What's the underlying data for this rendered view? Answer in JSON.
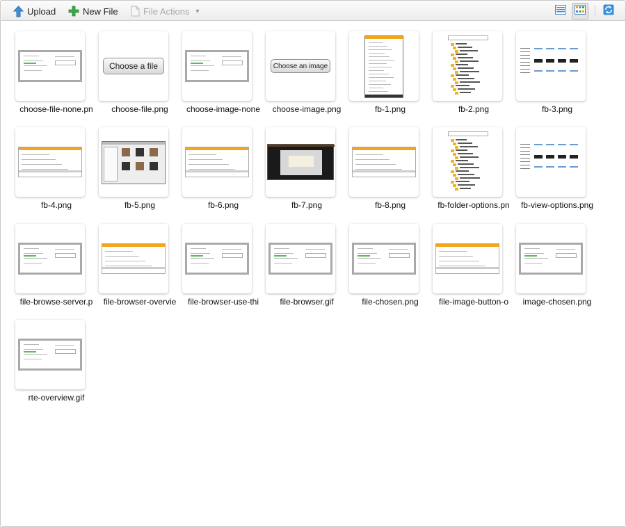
{
  "toolbar": {
    "upload_label": "Upload",
    "new_file_label": "New File",
    "file_actions_label": "File Actions"
  },
  "icons": {
    "upload": "arrow-up-icon",
    "new_file": "plus-icon",
    "file_actions": "document-icon",
    "list_view": "list-view-icon",
    "thumbnail_view": "thumbnail-view-icon",
    "refresh": "refresh-icon"
  },
  "colors": {
    "accent_orange": "#f4a51c",
    "plus_green": "#3aa64a",
    "upload_blue": "#3d8fd6"
  },
  "files": [
    {
      "name": "choose-file-none.pn",
      "thumb": "shot-light",
      "caption": ""
    },
    {
      "name": "choose-file.png",
      "thumb": "button",
      "caption": "Choose a file"
    },
    {
      "name": "choose-image-none",
      "thumb": "shot-light",
      "caption": ""
    },
    {
      "name": "choose-image.png",
      "thumb": "button-small",
      "caption": "Choose an image"
    },
    {
      "name": "fb-1.png",
      "thumb": "tall-panel",
      "caption": ""
    },
    {
      "name": "fb-2.png",
      "thumb": "tree",
      "caption": ""
    },
    {
      "name": "fb-3.png",
      "thumb": "tree-grid",
      "caption": ""
    },
    {
      "name": "fb-4.png",
      "thumb": "orange-window",
      "caption": ""
    },
    {
      "name": "fb-5.png",
      "thumb": "dialog",
      "caption": ""
    },
    {
      "name": "fb-6.png",
      "thumb": "orange-window",
      "caption": ""
    },
    {
      "name": "fb-7.png",
      "thumb": "dark-shot",
      "caption": ""
    },
    {
      "name": "fb-8.png",
      "thumb": "orange-window",
      "caption": ""
    },
    {
      "name": "fb-folder-options.pn",
      "thumb": "tree",
      "caption": ""
    },
    {
      "name": "fb-view-options.png",
      "thumb": "tree-grid",
      "caption": ""
    },
    {
      "name": "file-browse-server.p",
      "thumb": "shot-light",
      "caption": ""
    },
    {
      "name": "file-browser-overvie",
      "thumb": "orange-window",
      "caption": ""
    },
    {
      "name": "file-browser-use-thi",
      "thumb": "shot-light",
      "caption": ""
    },
    {
      "name": "file-browser.gif",
      "thumb": "shot-light",
      "caption": ""
    },
    {
      "name": "file-chosen.png",
      "thumb": "shot-light",
      "caption": ""
    },
    {
      "name": "file-image-button-o",
      "thumb": "orange-window",
      "caption": ""
    },
    {
      "name": "image-chosen.png",
      "thumb": "shot-light",
      "caption": ""
    },
    {
      "name": "rte-overview.gif",
      "thumb": "shot-light",
      "caption": ""
    }
  ]
}
